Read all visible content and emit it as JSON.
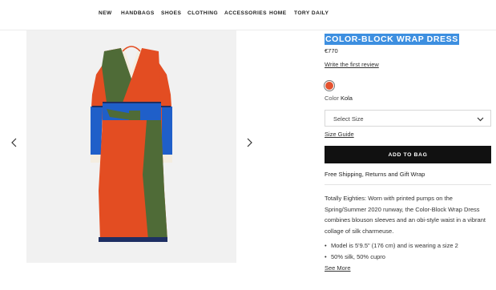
{
  "nav": {
    "items": [
      "NEW",
      "HANDBAGS",
      "SHOES",
      "CLOTHING",
      "ACCESSORIES",
      "HOME",
      "TORY DAILY"
    ]
  },
  "product": {
    "title": "COLOR-BLOCK WRAP DRESS",
    "price": "€770",
    "review_link": "Write the first review",
    "color_label": "Color",
    "color_value": "Kola",
    "swatch_color": "#e4522f",
    "size_placeholder": "Select Size",
    "size_guide": "Size Guide",
    "add_to_bag": "ADD TO BAG",
    "shipping": "Free Shipping, Returns and Gift Wrap",
    "description": "Totally Eighties: Worn with printed pumps on the Spring/Summer 2020 runway, the Color-Block Wrap Dress combines blouson sleeves and an obi-style waist in a vibrant collage of silk charmeuse.",
    "bullets": [
      "Model is 5'9.5\" (176 cm) and is wearing a size 2",
      "50% silk, 50% cupro"
    ],
    "see_more": "See More"
  },
  "gallery": {
    "prev_icon": "chevron-left-icon",
    "next_icon": "chevron-right-icon",
    "dress_colors": {
      "orange": "#e34d22",
      "blue": "#1f5fc9",
      "green": "#4f6b37",
      "navy": "#1e2f63",
      "cream": "#f4ede0"
    }
  },
  "colors": {
    "title_highlight": "#3d8fe0",
    "button_bg": "#111111"
  }
}
